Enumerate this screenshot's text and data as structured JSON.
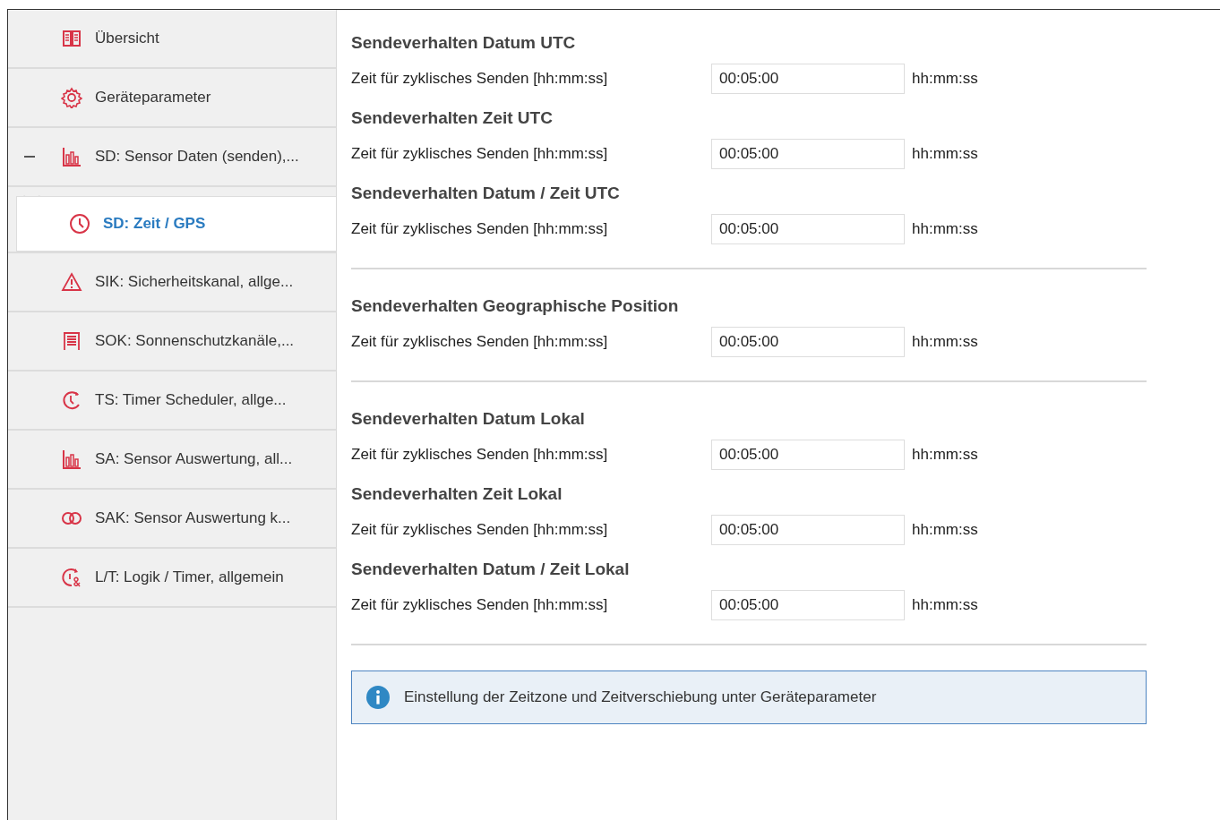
{
  "sidebar": {
    "items": [
      {
        "label": "Übersicht",
        "kind": "book",
        "selected": false
      },
      {
        "label": "Geräteparameter",
        "kind": "gear",
        "selected": false
      },
      {
        "label": "SD: Sensor Daten (senden),...",
        "kind": "chart",
        "selected": false,
        "expanded": true,
        "children": [
          {
            "label": "SD: Zeit / GPS",
            "kind": "clock",
            "selected": true
          }
        ]
      },
      {
        "label": "SIK: Sicherheitskanal, allge...",
        "kind": "warning",
        "selected": false
      },
      {
        "label": "SOK: Sonnenschutzkanäle,...",
        "kind": "blinds",
        "selected": false
      },
      {
        "label": "TS: Timer Scheduler, allge...",
        "kind": "timer",
        "selected": false
      },
      {
        "label": "SA: Sensor Auswertung, all...",
        "kind": "chart",
        "selected": false
      },
      {
        "label": "SAK: Sensor Auswertung k...",
        "kind": "rings",
        "selected": false
      },
      {
        "label": "L/T: Logik / Timer, allgemein",
        "kind": "logic",
        "selected": false
      }
    ]
  },
  "content": {
    "groups": [
      {
        "sections": [
          {
            "title": "Sendeverhalten Datum UTC",
            "rows": [
              {
                "label": "Zeit für zyklisches Senden [hh:mm:ss]",
                "value": "00:05:00",
                "unit": "hh:mm:ss"
              }
            ]
          },
          {
            "title": "Sendeverhalten Zeit UTC",
            "rows": [
              {
                "label": "Zeit für zyklisches Senden [hh:mm:ss]",
                "value": "00:05:00",
                "unit": "hh:mm:ss"
              }
            ]
          },
          {
            "title": "Sendeverhalten Datum / Zeit UTC",
            "rows": [
              {
                "label": "Zeit für zyklisches Senden [hh:mm:ss]",
                "value": "00:05:00",
                "unit": "hh:mm:ss"
              }
            ]
          }
        ]
      },
      {
        "sections": [
          {
            "title": "Sendeverhalten Geographische Position",
            "rows": [
              {
                "label": "Zeit für zyklisches Senden [hh:mm:ss]",
                "value": "00:05:00",
                "unit": "hh:mm:ss"
              }
            ]
          }
        ]
      },
      {
        "sections": [
          {
            "title": "Sendeverhalten Datum Lokal",
            "rows": [
              {
                "label": "Zeit für zyklisches Senden [hh:mm:ss]",
                "value": "00:05:00",
                "unit": "hh:mm:ss"
              }
            ]
          },
          {
            "title": "Sendeverhalten Zeit Lokal",
            "rows": [
              {
                "label": "Zeit für zyklisches Senden [hh:mm:ss]",
                "value": "00:05:00",
                "unit": "hh:mm:ss"
              }
            ]
          },
          {
            "title": "Sendeverhalten Datum / Zeit Lokal",
            "rows": [
              {
                "label": "Zeit für zyklisches Senden [hh:mm:ss]",
                "value": "00:05:00",
                "unit": "hh:mm:ss"
              }
            ]
          }
        ]
      }
    ],
    "info": "Einstellung der Zeitzone und Zeitverschiebung unter Geräteparameter"
  }
}
